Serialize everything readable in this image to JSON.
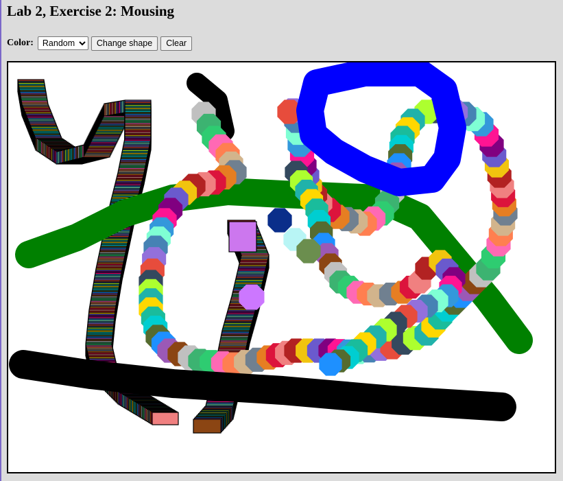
{
  "page": {
    "title": "Lab 2, Exercise 2: Mousing"
  },
  "controls": {
    "color_label": "Color:",
    "color_selected": "Random",
    "color_options": [
      "Random"
    ],
    "change_shape_label": "Change shape",
    "clear_label": "Clear"
  },
  "canvas": {
    "background": "#ffffff",
    "stroke_colors": {
      "black": "#000000",
      "green": "#008000",
      "blue": "#0000ff"
    },
    "palette": [
      "#e74c3c",
      "#2ecc71",
      "#3498db",
      "#9b59b6",
      "#f1c40f",
      "#1abc9c",
      "#e67e22",
      "#34495e",
      "#ff69b4",
      "#7fffd4",
      "#8b4513",
      "#6a5acd",
      "#00ced1",
      "#dc143c",
      "#adff2f",
      "#ff7f50",
      "#4682b4",
      "#c0c0c0",
      "#800080",
      "#556b2f",
      "#f08080",
      "#20b2aa",
      "#d2b48c",
      "#9370db",
      "#3cb371",
      "#ff1493",
      "#1e90ff",
      "#b22222",
      "#ffd700",
      "#708090"
    ]
  }
}
